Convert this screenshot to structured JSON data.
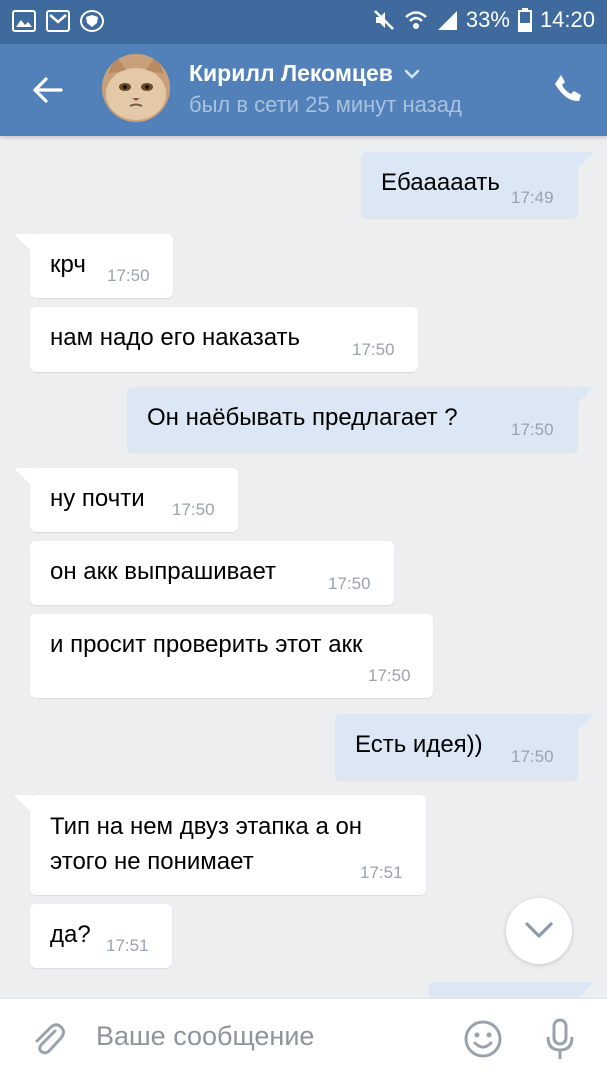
{
  "status_bar": {
    "battery_percent": "33%",
    "time": "14:20",
    "icons": [
      "gallery-icon",
      "gmail-icon",
      "shield-app-icon",
      "mute-icon",
      "wifi-icon",
      "signal-icon",
      "battery-icon"
    ]
  },
  "header": {
    "contact_name": "Кирилл Лекомцев",
    "last_seen": "был в сети 25 минут назад",
    "colors": {
      "bar": "#5181b8",
      "status_bar": "#3f6a9e"
    }
  },
  "messages": [
    {
      "dir": "out",
      "text": "Ебааааать",
      "time": "17:49"
    },
    {
      "dir": "in",
      "text": "крч",
      "time": "17:50"
    },
    {
      "dir": "in",
      "text": "нам надо его наказать",
      "time": "17:50"
    },
    {
      "dir": "out",
      "text": "Он наёбывать предлагает ?",
      "time": "17:50"
    },
    {
      "dir": "in",
      "text": "ну почти",
      "time": "17:50"
    },
    {
      "dir": "in",
      "text": "он акк выпрашивает",
      "time": "17:50"
    },
    {
      "dir": "in",
      "text": "и просит проверить этот акк",
      "time": "17:50"
    },
    {
      "dir": "out",
      "text": "Есть идея))",
      "time": "17:50"
    },
    {
      "dir": "in",
      "text": "Тип на нем двуз этапка а он\nэтого не понимает",
      "time": "17:51"
    },
    {
      "dir": "in",
      "text": "да?",
      "time": "17:51"
    }
  ],
  "composer": {
    "placeholder": "Ваше сообщение"
  }
}
